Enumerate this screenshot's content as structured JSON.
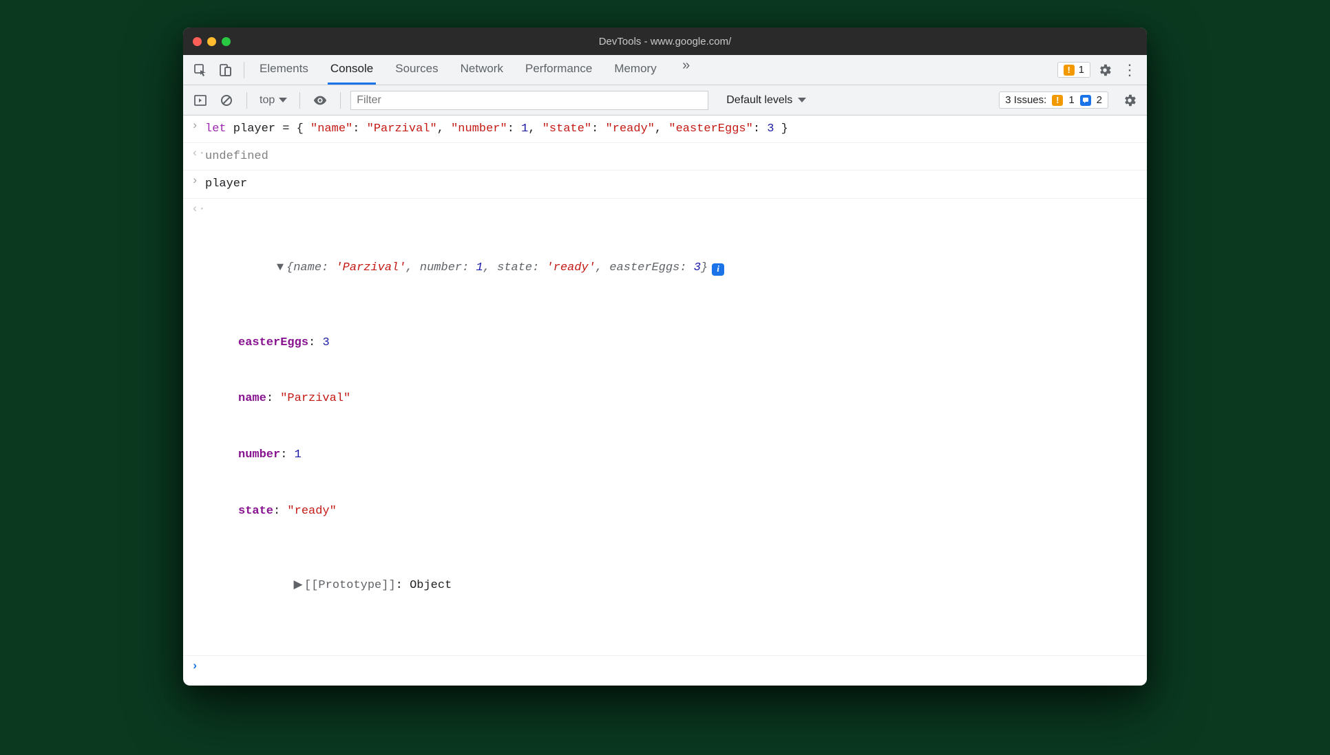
{
  "title": "DevTools - www.google.com/",
  "tabs": [
    "Elements",
    "Console",
    "Sources",
    "Network",
    "Performance",
    "Memory"
  ],
  "activeTab": "Console",
  "topWarnCount": "1",
  "filterPlaceholder": "Filter",
  "contextLabel": "top",
  "levelsLabel": "Default levels",
  "issues": {
    "label": "3 Issues:",
    "warn": "1",
    "info": "2"
  },
  "lines": {
    "input1_let": "let",
    "input1_rest_a": " player = { ",
    "input1_k1": "\"name\"",
    "input1_v1": "\"Parzival\"",
    "input1_k2": "\"number\"",
    "input1_v2": "1",
    "input1_k3": "\"state\"",
    "input1_v3": "\"ready\"",
    "input1_k4": "\"easterEggs\"",
    "input1_v4": "3",
    "undefined": "undefined",
    "input2": "player",
    "preview_open": "{name: ",
    "preview_v1": "'Parzival'",
    "preview_sep1": ", number: ",
    "preview_v2": "1",
    "preview_sep2": ", state: ",
    "preview_v3": "'ready'",
    "preview_sep3": ", easterEggs: ",
    "preview_v4": "3",
    "preview_close": "}",
    "props": {
      "p1k": "easterEggs",
      "p1v": "3",
      "p2k": "name",
      "p2v": "\"Parzival\"",
      "p3k": "number",
      "p3v": "1",
      "p4k": "state",
      "p4v": "\"ready\""
    },
    "proto_label": "[[Prototype]]",
    "proto_value": "Object",
    "colon": ": ",
    "comma": ", ",
    "close_brace": " }"
  }
}
